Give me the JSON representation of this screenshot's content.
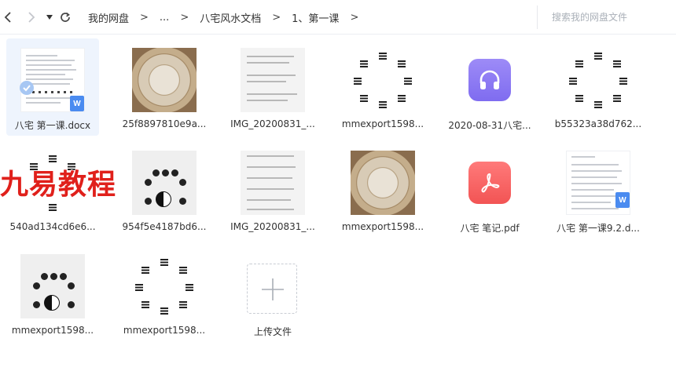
{
  "toolbar": {
    "breadcrumbs": [
      "我的网盘",
      "...",
      "八宅风水文档",
      "1、第一课"
    ],
    "separator": ">",
    "search_placeholder": "搜索我的网盘文件"
  },
  "files": [
    {
      "name": "八宅 第一课.docx",
      "type": "docx",
      "selected": true
    },
    {
      "name": "25f8897810e9a...",
      "type": "photo"
    },
    {
      "name": "IMG_20200831_...",
      "type": "text-image"
    },
    {
      "name": "mmexport1598...",
      "type": "bagua"
    },
    {
      "name": "2020-08-31八宅...",
      "type": "audio"
    },
    {
      "name": "b55323a38d762...",
      "type": "bagua"
    },
    {
      "name": "540ad134cd6e6...",
      "type": "bagua"
    },
    {
      "name": "954f5e4187bd6...",
      "type": "chart"
    },
    {
      "name": "IMG_20200831_...",
      "type": "text-image"
    },
    {
      "name": "mmexport1598...",
      "type": "photo"
    },
    {
      "name": "八宅 笔记.pdf",
      "type": "pdf"
    },
    {
      "name": "八宅 第一课9.2.d...",
      "type": "docx"
    },
    {
      "name": "mmexport1598...",
      "type": "chart"
    },
    {
      "name": "mmexport1598...",
      "type": "bagua"
    }
  ],
  "upload": {
    "label": "上传文件"
  },
  "watermark": {
    "text": "九易教程"
  },
  "colors": {
    "accent": "#4a8bf0",
    "audio": "#8a78f4",
    "pdf": "#f25a5a",
    "watermark": "#e0201b"
  }
}
